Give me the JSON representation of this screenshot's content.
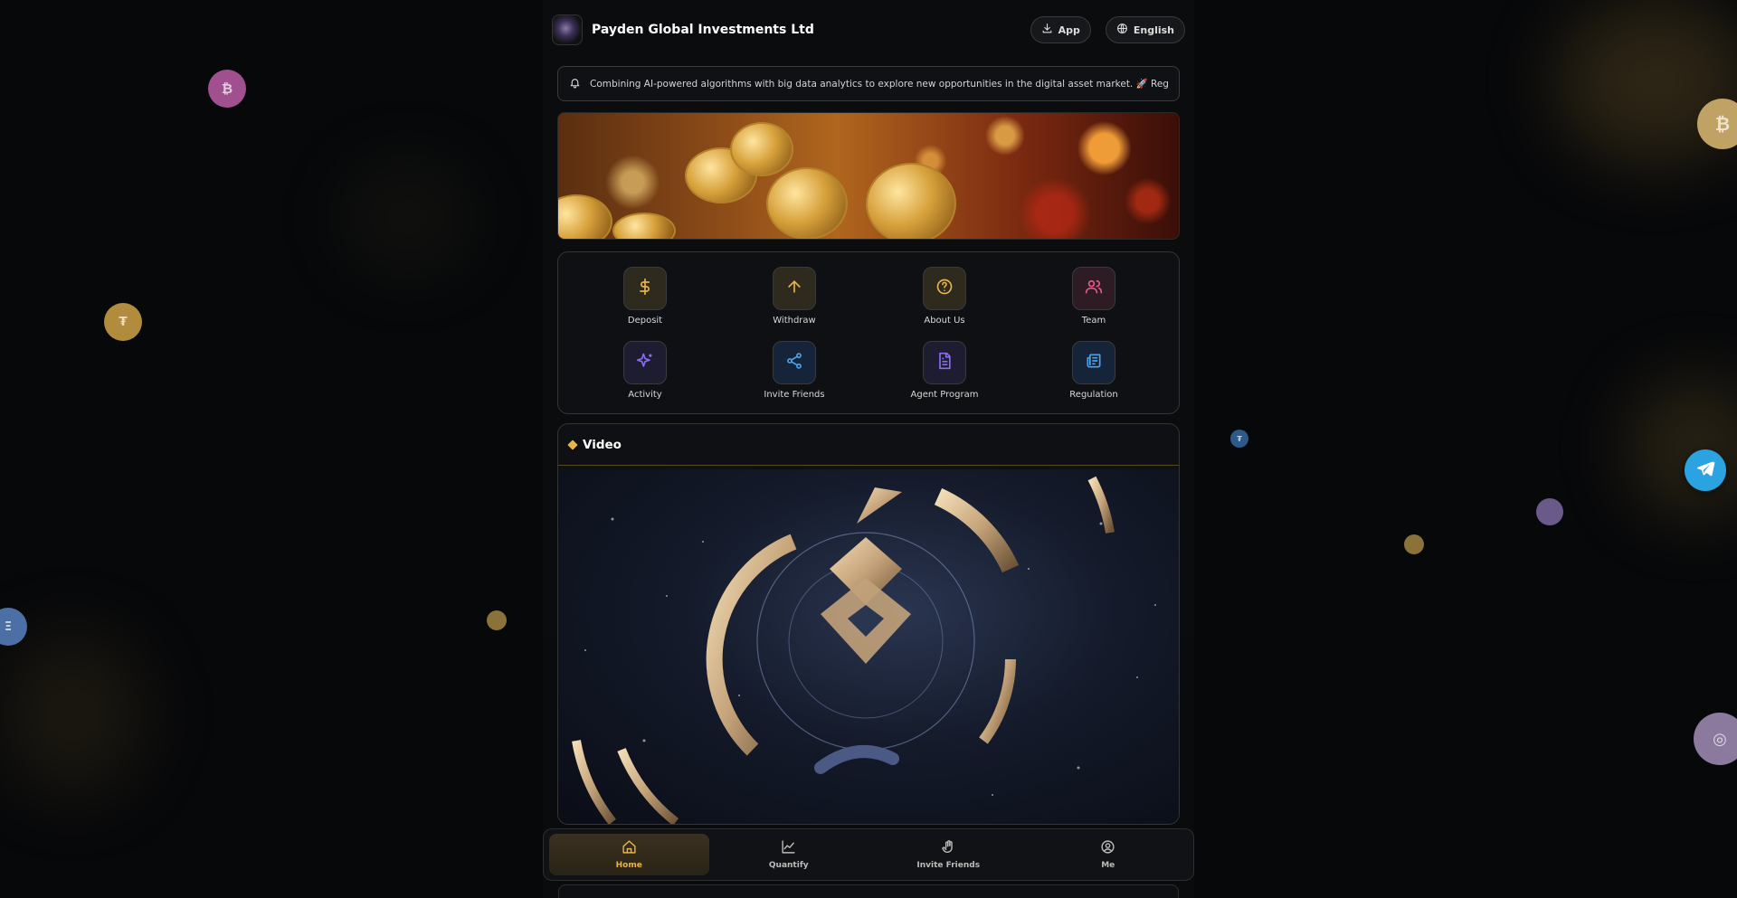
{
  "header": {
    "brand_name": "Payden Global Investments Ltd",
    "app_button_label": "App",
    "language_button_label": "English"
  },
  "notice": {
    "text": "Combining AI-powered algorithms with big data analytics to explore new opportunities in the digital asset market. 🚀 Register now"
  },
  "menu": {
    "items": [
      {
        "label": "Deposit",
        "icon": "dollar-icon",
        "color": "#e8b44a"
      },
      {
        "label": "Withdraw",
        "icon": "arrow-up-icon",
        "color": "#e8b44a"
      },
      {
        "label": "About Us",
        "icon": "question-icon",
        "color": "#e8b44a"
      },
      {
        "label": "Team",
        "icon": "users-icon",
        "color": "#e25b8a"
      },
      {
        "label": "Activity",
        "icon": "sparkles-icon",
        "color": "#8b6cf0"
      },
      {
        "label": "Invite Friends",
        "icon": "share-icon",
        "color": "#4aa3e8"
      },
      {
        "label": "Agent Program",
        "icon": "document-icon",
        "color": "#8b6cf0"
      },
      {
        "label": "Regulation",
        "icon": "newspaper-icon",
        "color": "#4aa3e8"
      }
    ]
  },
  "video": {
    "title": "Video"
  },
  "tabbar": {
    "tabs": [
      {
        "label": "Home",
        "icon": "home-icon",
        "active": true
      },
      {
        "label": "Quantify",
        "icon": "chart-icon",
        "active": false
      },
      {
        "label": "Invite Friends",
        "icon": "hand-wave-icon",
        "active": false
      },
      {
        "label": "Me",
        "icon": "user-circle-icon",
        "active": false
      }
    ]
  },
  "floating_coins": [
    "₿",
    "₮",
    "Ξ",
    "₮",
    "₿",
    "◎"
  ],
  "colors": {
    "accent": "#e6b44a",
    "telegram": "#2aa3e0"
  }
}
